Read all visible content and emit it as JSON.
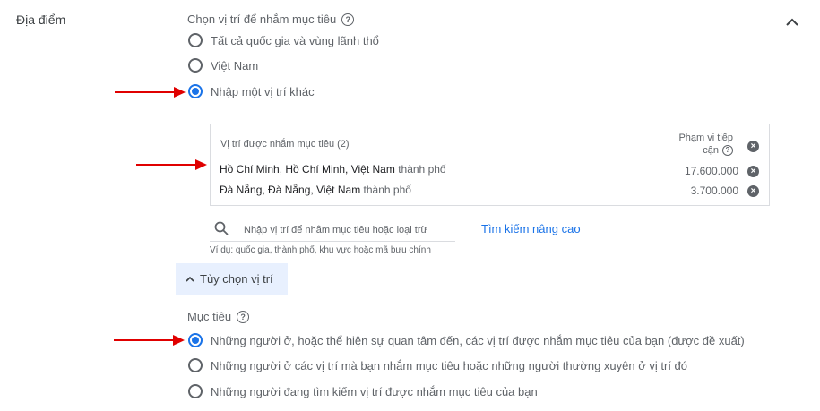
{
  "section": {
    "label": "Địa điểm"
  },
  "location_target": {
    "heading": "Chọn vị trí để nhắm mục tiêu",
    "options": [
      {
        "label": "Tất cả quốc gia và vùng lãnh thổ",
        "checked": false
      },
      {
        "label": "Việt Nam",
        "checked": false
      },
      {
        "label": "Nhập một vị trí khác",
        "checked": true
      }
    ]
  },
  "targeted_panel": {
    "title": "Vị trí được nhắm mục tiêu (2)",
    "reach_header_line1": "Phạm vi tiếp",
    "reach_header_line2": "cận",
    "rows": [
      {
        "name": "Hồ Chí Minh, Hồ Chí Minh, Việt Nam",
        "type": "thành phố",
        "reach": "17.600.000"
      },
      {
        "name": "Đà Nẵng, Đà Nẵng, Việt Nam",
        "type": "thành phố",
        "reach": "3.700.000"
      }
    ]
  },
  "search": {
    "placeholder": "Nhập vị trí để nhắm mục tiêu hoặc loại trừ",
    "advanced_link": "Tìm kiếm nâng cao",
    "hint": "Ví dụ: quốc gia, thành phố, khu vực hoặc mã bưu chính"
  },
  "location_options_button": {
    "label": "Tùy chọn vị trí"
  },
  "objective": {
    "heading": "Mục tiêu",
    "options": [
      {
        "label": "Những người ở, hoặc thể hiện sự quan tâm đến, các vị trí được nhắm mục tiêu của bạn (được đề xuất)",
        "checked": true
      },
      {
        "label": "Những người ở các vị trí mà bạn nhắm mục tiêu hoặc những người thường xuyên ở vị trí đó",
        "checked": false
      },
      {
        "label": "Những người đang tìm kiếm vị trí được nhắm mục tiêu của bạn",
        "checked": false
      }
    ]
  },
  "icons": {
    "help": "help-circle-icon",
    "remove": "close-circle-icon",
    "collapse": "chevron-up-icon",
    "search": "search-icon",
    "arrow": "red-arrow-annotation"
  },
  "colors": {
    "accent": "#1a73e8",
    "arrow": "#e00000",
    "options_bg": "#e8f0fe"
  }
}
